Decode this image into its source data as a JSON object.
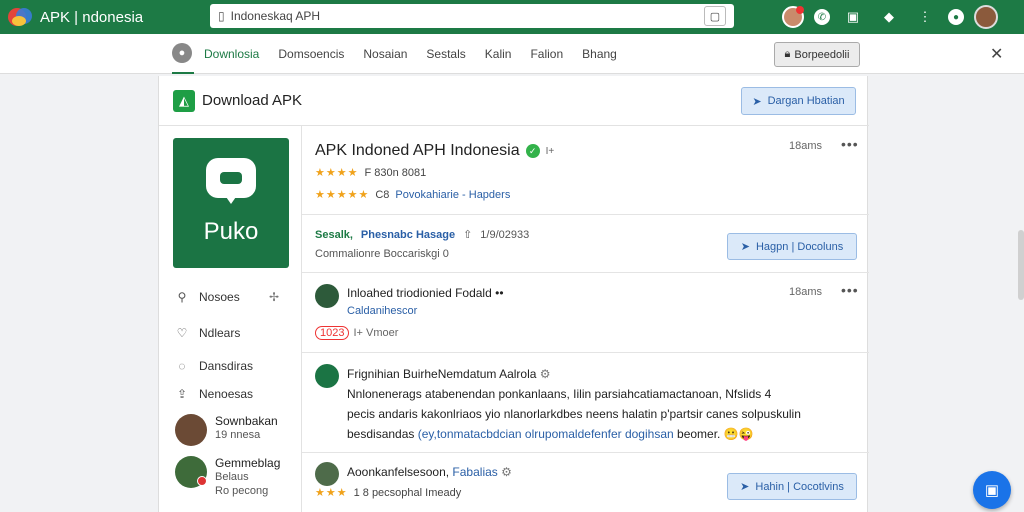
{
  "browser": {
    "title": "APK | ndonesia",
    "url": "Indoneskaq APH",
    "icons": [
      "avatar-icon",
      "whatsapp-icon",
      "download-icon",
      "tag-icon",
      "grid-icon",
      "circle-icon",
      "profile-icon"
    ]
  },
  "nav": {
    "tabs": [
      "Downlosia",
      "Domsoencis",
      "Nosaian",
      "Sestals",
      "Kalin",
      "Falion",
      "Bhang"
    ],
    "active_tab": "Downlosia",
    "button_label": "Borpeedolii"
  },
  "header": {
    "title": "Download APK",
    "button_label": "Dargan Hbatian"
  },
  "app": {
    "icon_label": "Puko",
    "name": "APK Indoned APH Indonesia",
    "name_suffix": "I+",
    "time": "18ams",
    "rating_text": "F 830n 8081",
    "rating2_count": "C8",
    "rating2_link": "Povokahiarie - Hapders"
  },
  "sidebar": {
    "items": [
      {
        "label": "Nosoes",
        "icon": "search-icon"
      },
      {
        "label": "Ndlears",
        "icon": "heart-icon"
      },
      {
        "label": "Dansdiras",
        "icon": "chat-icon"
      },
      {
        "label": "Nenoesas",
        "icon": "share-icon"
      }
    ],
    "users": [
      {
        "name": "Sownbakan",
        "sub": "19 nnesa"
      },
      {
        "name": "Gemmeblag",
        "sub": "Belaus",
        "sub2": "Ro pecong"
      }
    ]
  },
  "section2": {
    "tag1": "Sesalk,",
    "tag2": "Phesnabc Hasage",
    "meta": "1/9/02933",
    "subtitle": "Commalionre Boccariskgi 0",
    "button_label": "Hagpn | Docoluns"
  },
  "post1": {
    "name": "Inloahed triodionied Fodald",
    "name_suffix": "••",
    "sub": "Caldanihescor",
    "tag_red": "1023",
    "tag_suffix": "I+ Vmoer",
    "time": "18ams"
  },
  "post2": {
    "title": "Frignihian BuirheNemdatum Aalrola",
    "body_line1": "Nnlonenerags atabenendan ponkanlaans, Iilin parsiahcatiamactanoan, Nfslids",
    "body_num": "4",
    "body_line2": "pecis andaris kakonlriaos yio nlanorlarkdbes neens halatin p'partsir canes solpuskulin",
    "body_line3a": "besdisandas",
    "body_line3b": "(ey,tonmatacbdcian olrupomaldefenfer dogihsan",
    "body_line3c": "beomer.",
    "emoji": "😬😜"
  },
  "post3": {
    "name": "Aoonkanfelsesoon,",
    "name_link": "Fabalias",
    "stars_text": "1 8 pecsophal Imeady",
    "button_label": "Hahin | Cocotlvins"
  }
}
